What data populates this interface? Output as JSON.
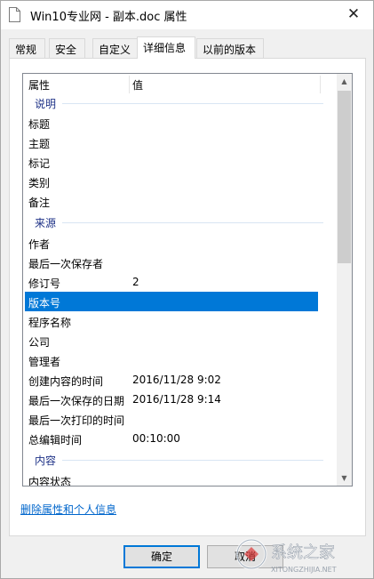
{
  "window": {
    "title": "Win10专业网 - 副本.doc 属性",
    "close_glyph": "✕"
  },
  "tabs": [
    {
      "label": "常规"
    },
    {
      "label": "安全"
    },
    {
      "label": "自定义"
    },
    {
      "label": "详细信息"
    },
    {
      "label": "以前的版本"
    }
  ],
  "list": {
    "header": {
      "property": "属性",
      "value": "值"
    },
    "groups": {
      "description": "说明",
      "origin": "来源",
      "content": "内容"
    },
    "rows": [
      {
        "key": "标题",
        "value": ""
      },
      {
        "key": "主题",
        "value": ""
      },
      {
        "key": "标记",
        "value": ""
      },
      {
        "key": "类别",
        "value": ""
      },
      {
        "key": "备注",
        "value": ""
      },
      {
        "key": "作者",
        "value": ""
      },
      {
        "key": "最后一次保存者",
        "value": ""
      },
      {
        "key": "修订号",
        "value": "2"
      },
      {
        "key": "版本号",
        "value": ""
      },
      {
        "key": "程序名称",
        "value": ""
      },
      {
        "key": "公司",
        "value": ""
      },
      {
        "key": "管理者",
        "value": ""
      },
      {
        "key": "创建内容的时间",
        "value": "2016/11/28 9:02"
      },
      {
        "key": "最后一次保存的日期",
        "value": "2016/11/28 9:14"
      },
      {
        "key": "最后一次打印的时间",
        "value": ""
      },
      {
        "key": "总编辑时间",
        "value": "00:10:00"
      },
      {
        "key": "内容状态",
        "value": ""
      }
    ],
    "selected_row": "版本号"
  },
  "scrollbar": {
    "up_glyph": "▲",
    "down_glyph": "▼"
  },
  "link": {
    "remove_properties": "删除属性和个人信息"
  },
  "buttons": {
    "ok": "确定",
    "cancel": "取消"
  },
  "watermark": {
    "text": "系统之家",
    "url": "XITONGZHIJIA.NET"
  }
}
